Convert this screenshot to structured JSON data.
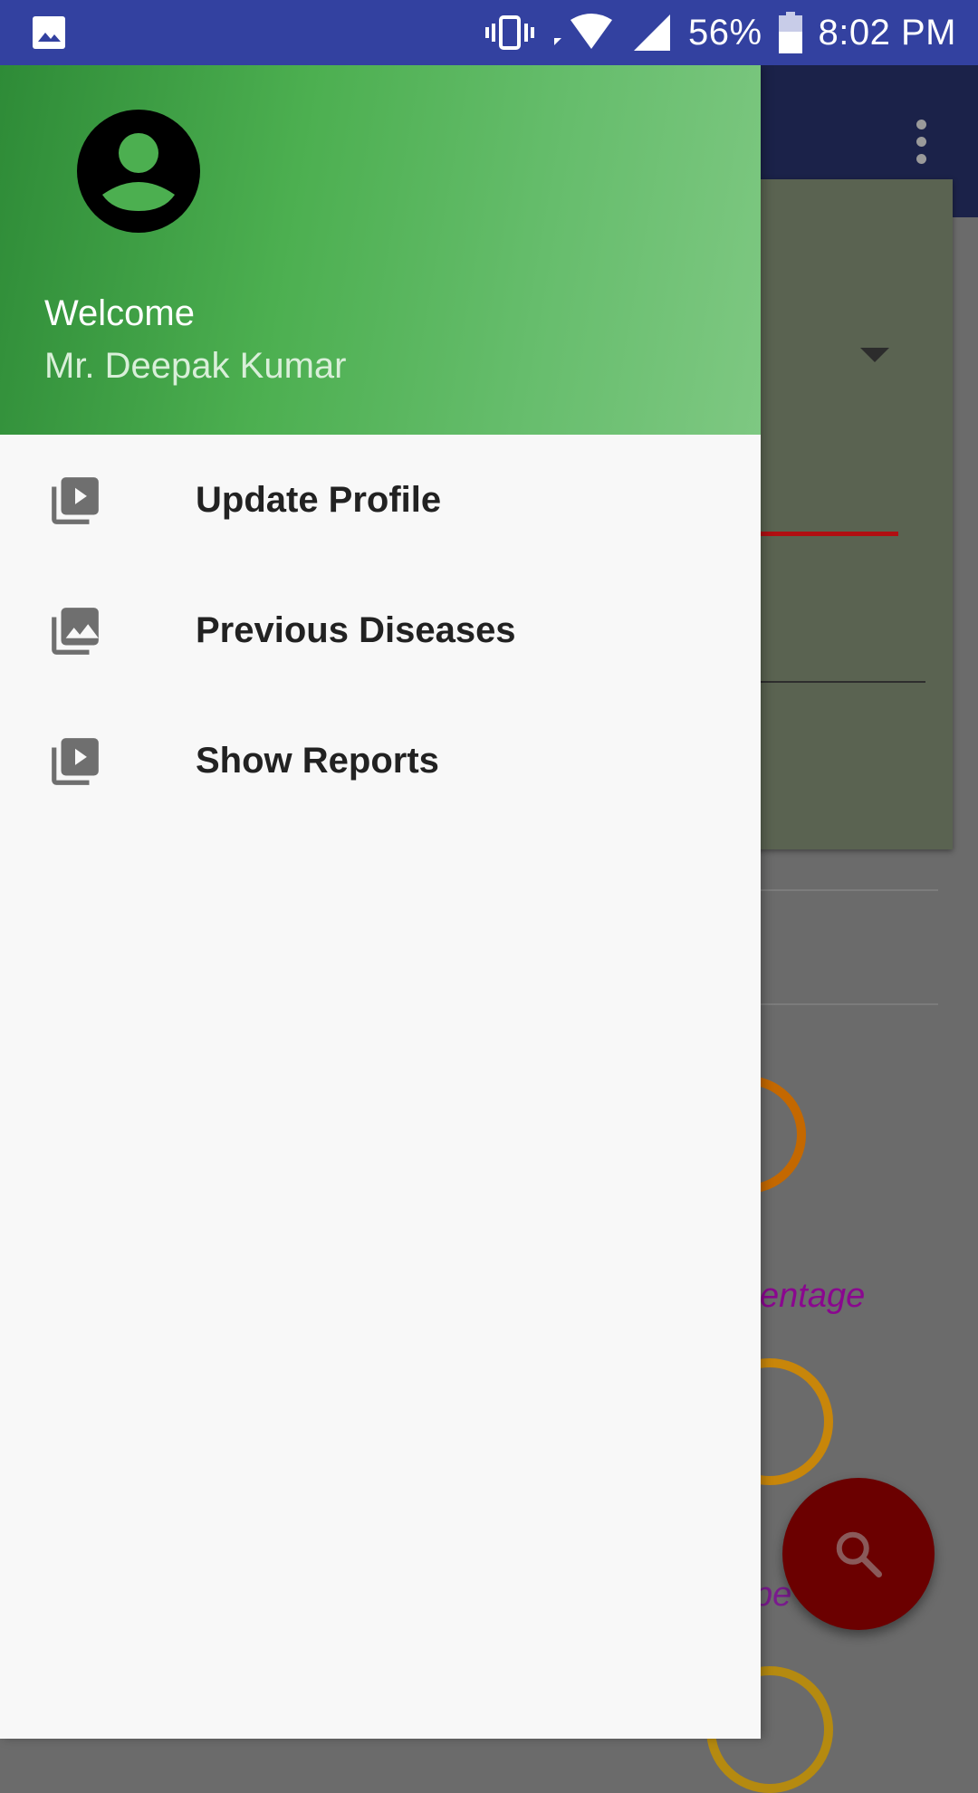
{
  "status_bar": {
    "battery_percent": "56%",
    "time": "8:02 PM",
    "icons": [
      "image-notification-icon",
      "vibrate-icon",
      "wifi-icon",
      "cell-signal-icon",
      "battery-icon"
    ]
  },
  "drawer": {
    "header": {
      "greeting": "Welcome",
      "user_name": "Mr. Deepak Kumar",
      "avatar_icon": "account-circle-icon",
      "gradient_colors": [
        "#2e8b37",
        "#4caf50",
        "#7ec882"
      ]
    },
    "items": [
      {
        "label": "Update Profile",
        "icon": "video-library-icon"
      },
      {
        "label": "Previous Diseases",
        "icon": "photo-library-icon"
      },
      {
        "label": "Show Reports",
        "icon": "video-library-icon"
      }
    ]
  },
  "background_app": {
    "partial_label_1": "centage",
    "partial_label_2": "pe",
    "partial_label_2_tail": "e",
    "fab_icon": "search-icon",
    "colors": {
      "toolbar": "#1b2249",
      "fab": "#6b0000",
      "accent_line": "#b00f12",
      "label_text": "#8a078f"
    }
  }
}
